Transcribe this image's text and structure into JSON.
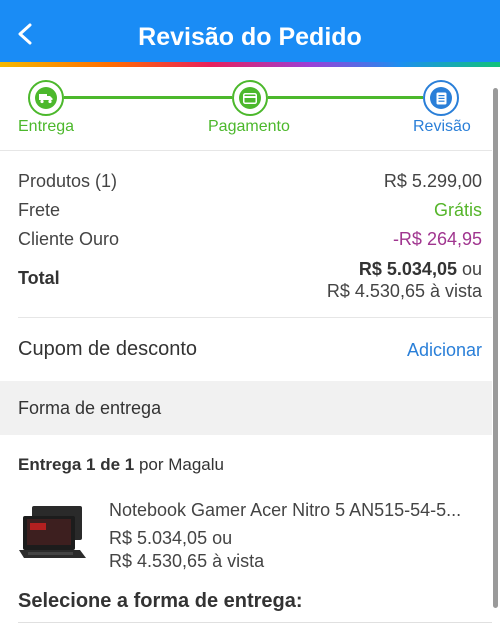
{
  "header": {
    "title": "Revisão do Pedido"
  },
  "steps": [
    {
      "label": "Entrega",
      "icon": "truck-icon",
      "status": "done"
    },
    {
      "label": "Pagamento",
      "icon": "card-icon",
      "status": "done"
    },
    {
      "label": "Revisão",
      "icon": "document-icon",
      "status": "active"
    }
  ],
  "summary": {
    "products_label": "Produtos (1)",
    "products_value": "R$ 5.299,00",
    "shipping_label": "Frete",
    "shipping_value": "Grátis",
    "gold_label": "Cliente Ouro",
    "gold_value": "-R$ 264,95",
    "total_label": "Total",
    "total_value_prefix": "R$ 5.034,05",
    "total_value_suffix": " ou",
    "total_cash": "R$ 4.530,65 à vista"
  },
  "coupon": {
    "label": "Cupom de desconto",
    "action": "Adicionar"
  },
  "delivery_section": {
    "title": "Forma de entrega"
  },
  "delivery": {
    "heading_bold": "Entrega 1 de 1",
    "heading_rest": " por Magalu",
    "product_name": "Notebook Gamer Acer Nitro 5 AN515-54-5...",
    "product_price": "R$ 5.034,05 ou",
    "product_cash": "R$ 4.530,65 à vista",
    "select_label": "Selecione a forma de entrega:"
  },
  "colors": {
    "header_bg": "#1a8cf5",
    "step_done": "#4cb82c",
    "step_active": "#2a7fd8",
    "discount": "#a0358f",
    "free": "#55b52a",
    "link": "#2a7fd8"
  }
}
